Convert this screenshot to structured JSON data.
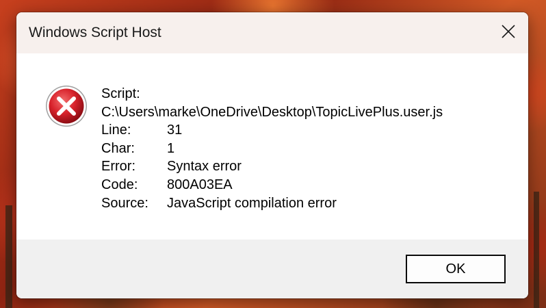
{
  "window": {
    "title": "Windows Script Host",
    "close_icon": "close-icon"
  },
  "dialog": {
    "icon": "error-icon",
    "script_label": "Script:",
    "script_path": "C:\\Users\\marke\\OneDrive\\Desktop\\TopicLivePlus.user.js",
    "fields": [
      {
        "label": "Line:",
        "value": "31"
      },
      {
        "label": "Char:",
        "value": "1"
      },
      {
        "label": "Error:",
        "value": "Syntax error"
      },
      {
        "label": "Code:",
        "value": "800A03EA"
      },
      {
        "label": "Source:",
        "value": "JavaScript compilation error"
      }
    ]
  },
  "footer": {
    "ok_label": "OK"
  },
  "colors": {
    "titlebar_bg": "#f7f0ed",
    "footer_bg": "#f0f0f0",
    "error_red": "#c8102e"
  }
}
